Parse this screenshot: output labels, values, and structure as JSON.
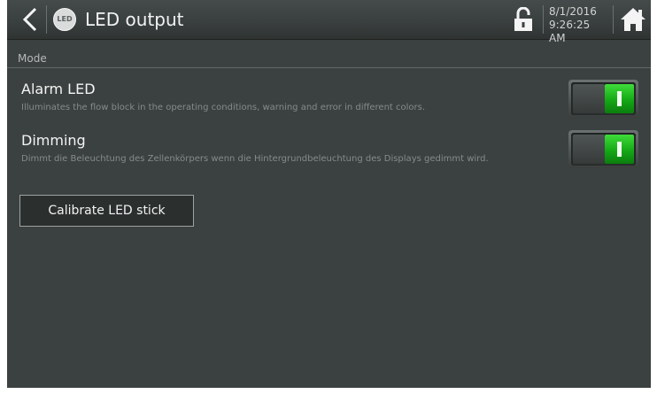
{
  "header": {
    "title": "LED output",
    "led_icon_text": "LED",
    "date": "8/1/2016",
    "time": "9:26:25 AM",
    "icons": {
      "back": "chevron-left-icon",
      "led": "led-icon",
      "lock": "unlocked-padlock-icon",
      "home": "home-icon"
    }
  },
  "section": {
    "label": "Mode"
  },
  "settings": [
    {
      "title": "Alarm LED",
      "description": "Illuminates the flow block in the operating conditions, warning and error in different colors.",
      "enabled": true
    },
    {
      "title": "Dimming",
      "description": "Dimmt die Beleuchtung des Zellenkörpers wenn die Hintergrundbeleuchtung des Displays gedimmt wird.",
      "enabled": true
    }
  ],
  "actions": {
    "calibrate_label": "Calibrate LED stick"
  },
  "colors": {
    "background": "#3b4140",
    "toggle_on": "#14a816",
    "text": "#f4f4f4"
  }
}
